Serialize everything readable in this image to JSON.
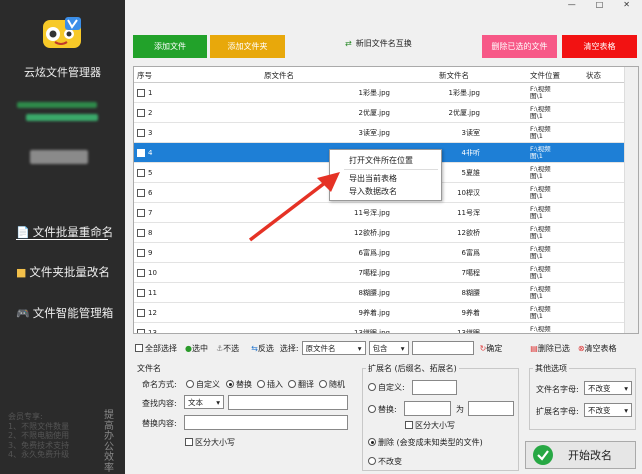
{
  "app": {
    "title": "云炫文件管理器",
    "window_controls": [
      "—",
      "□",
      "✕"
    ]
  },
  "sidebar": {
    "items": [
      {
        "label": "文件批量重命名",
        "icon": "document-icon"
      },
      {
        "label": "文件夹批量改名",
        "icon": "folder-icon"
      },
      {
        "label": "文件智能管理箱",
        "icon": "toolbox-icon"
      }
    ],
    "member_lines": [
      "会员专享:",
      "1、不限文件数量",
      "2、不限电脑使用",
      "3、免费技术支持",
      "4、永久免费升级"
    ],
    "promo": "提高办公效率"
  },
  "toolbar": {
    "add_file": "添加文件",
    "add_folder": "添加文件夹",
    "swap": "新旧文件名互换",
    "delete_selected": "删除已选的文件",
    "clear_table": "清空表格",
    "colors": {
      "add_file": "#22a22a",
      "add_folder": "#e8a80b",
      "delete_selected": "#f75887",
      "clear_table": "#f21212"
    }
  },
  "table": {
    "headers": {
      "index": "序号",
      "original": "原文件名",
      "new": "新文件名",
      "location": "文件位置",
      "status": "状态"
    },
    "location_lines": [
      "F:\\视频",
      "图\\1"
    ],
    "rows": [
      {
        "n": "1",
        "orig": "1彩墨.jpg",
        "new": "1彩墨.jpg"
      },
      {
        "n": "2",
        "orig": "2优厦.jpg",
        "new": "2优厦.jpg"
      },
      {
        "n": "3",
        "orig": "3读室.jpg",
        "new": "3读室"
      },
      {
        "n": "4",
        "orig": "4非听.jpg",
        "new": "4非听",
        "selected": true
      },
      {
        "n": "5",
        "orig": "5夏誰.jpg",
        "new": "5夏誰"
      },
      {
        "n": "6",
        "orig": "10桿汉.jpg",
        "new": "10桿汉"
      },
      {
        "n": "7",
        "orig": "11号浑.jpg",
        "new": "11号浑"
      },
      {
        "n": "8",
        "orig": "12欲桥.jpg",
        "new": "12欲桥"
      },
      {
        "n": "9",
        "orig": "6富爲.jpg",
        "new": "6富爲"
      },
      {
        "n": "10",
        "orig": "7噶程.jpg",
        "new": "7噶程"
      },
      {
        "n": "11",
        "orig": "8糊腰.jpg",
        "new": "8糊腰"
      },
      {
        "n": "12",
        "orig": "9养着.jpg",
        "new": "9养着"
      },
      {
        "n": "13",
        "orig": "13继眠.jpg",
        "new": "13继眠"
      }
    ]
  },
  "context_menu": {
    "items": [
      "打开文件所在位置",
      "导出当前表格",
      "导入数据改名"
    ]
  },
  "controls": {
    "select_all": "全部选择",
    "select": "选中",
    "unselect": "不选",
    "invert": "反选",
    "choose_label": "选择:",
    "field_value": "原文件名",
    "match_value": "包含",
    "confirm": "确定",
    "delete_selected": "删除已选",
    "clear_table": "清空表格"
  },
  "filename_panel": {
    "title": "文件名",
    "mode_label": "命名方式:",
    "modes": [
      "自定义",
      "替换",
      "插入",
      "翻译",
      "随机"
    ],
    "active_mode": "替换",
    "find_label": "查找内容:",
    "find_type": "文本",
    "replace_label": "替换内容:",
    "case_label": "区分大小写"
  },
  "ext_panel": {
    "title": "扩展名 (后缀名、拓展名)",
    "custom": "自定义:",
    "replace": "替换:",
    "for_label": "为",
    "case_label": "区分大小写",
    "delete": "删除 (会变成未知类型的文件)",
    "no_change": "不改变"
  },
  "other_panel": {
    "title": "其他选项",
    "name_case_label": "文件名字母:",
    "name_case_value": "不改变",
    "ext_case_label": "扩展名字母:",
    "ext_case_value": "不改变"
  },
  "start_button": "开始改名"
}
